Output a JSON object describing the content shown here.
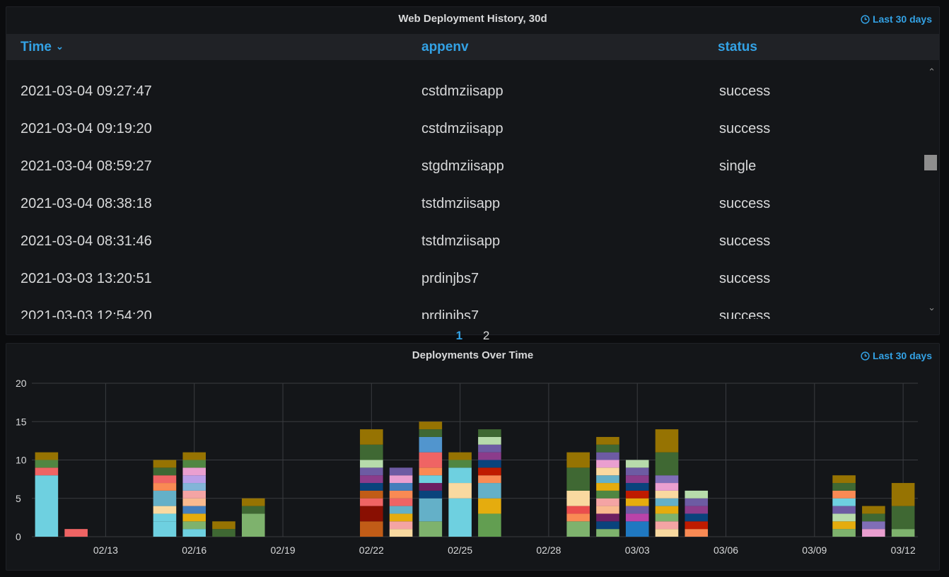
{
  "table_panel": {
    "title": "Web Deployment History, 30d",
    "time_range": "Last 30 days",
    "columns": [
      "Time",
      "appenv",
      "status"
    ],
    "rows": [
      [
        "2021-03-04 09:27:47",
        "cstdmziisapp",
        "success"
      ],
      [
        "2021-03-04 09:19:20",
        "cstdmziisapp",
        "success"
      ],
      [
        "2021-03-04 08:59:27",
        "stgdmziisapp",
        "single"
      ],
      [
        "2021-03-04 08:38:18",
        "tstdmziisapp",
        "success"
      ],
      [
        "2021-03-04 08:31:46",
        "tstdmziisapp",
        "success"
      ],
      [
        "2021-03-03 13:20:51",
        "prdinjbs7",
        "success"
      ],
      [
        "2021-03-03 12:54:20",
        "prdinjbs7",
        "success"
      ]
    ],
    "pages": [
      "1",
      "2"
    ],
    "active_page": "1"
  },
  "chart_panel": {
    "title": "Deployments Over Time",
    "time_range": "Last 30 days"
  },
  "colors": {
    "accent": "#33a2e5",
    "panel_bg": "#141619",
    "page_bg": "#0b0c0e",
    "grid": "#3a3c40"
  },
  "chart_data": {
    "type": "bar",
    "stacked": true,
    "xlabel": "",
    "ylabel": "",
    "ylim": [
      0,
      20
    ],
    "yticks": [
      0,
      5,
      10,
      15,
      20
    ],
    "xticks": [
      "02/13",
      "02/16",
      "02/19",
      "02/22",
      "02/25",
      "02/28",
      "03/03",
      "03/06",
      "03/09",
      "03/12"
    ],
    "x_range": [
      "02/11",
      "03/12"
    ],
    "grid": true,
    "legend": "none",
    "categories": [
      "02/11",
      "02/12",
      "02/15",
      "02/16",
      "02/17",
      "02/18",
      "02/22",
      "02/23",
      "02/24",
      "02/25",
      "02/26",
      "03/01",
      "03/02",
      "03/03",
      "03/04",
      "03/05",
      "03/10",
      "03/11",
      "03/12"
    ],
    "totals": [
      11,
      1,
      10,
      11,
      2,
      5,
      14,
      9,
      15,
      11,
      14,
      11,
      13,
      10,
      14,
      6,
      8,
      4,
      7
    ],
    "segments": [
      [
        [
          8,
          "#6ed0e0"
        ],
        [
          1,
          "#ef6464"
        ],
        [
          1,
          "#508642"
        ],
        [
          1,
          "#967302"
        ]
      ],
      [
        [
          1,
          "#ef6464"
        ]
      ],
      [
        [
          2,
          "#6ed0e0"
        ],
        [
          1,
          "#6ed0e0"
        ],
        [
          1,
          "#f9d9a0"
        ],
        [
          2,
          "#64b0c8"
        ],
        [
          1,
          "#f98a54"
        ],
        [
          1,
          "#ef6464"
        ],
        [
          1,
          "#3f6833"
        ],
        [
          1,
          "#967302"
        ]
      ],
      [
        [
          1,
          "#6ed0e0"
        ],
        [
          1,
          "#7eb26d"
        ],
        [
          1,
          "#e5ac0e"
        ],
        [
          1,
          "#447ebc"
        ],
        [
          1,
          "#f9ba8f"
        ],
        [
          1,
          "#f4a4a4"
        ],
        [
          1,
          "#82b5d8"
        ],
        [
          1,
          "#ba9ee8"
        ],
        [
          1,
          "#ea9fd0"
        ],
        [
          1,
          "#508642"
        ],
        [
          1,
          "#967302"
        ]
      ],
      [
        [
          1,
          "#3f6833"
        ],
        [
          1,
          "#967302"
        ]
      ],
      [
        [
          3,
          "#7eb26d"
        ],
        [
          1,
          "#3f6833"
        ],
        [
          1,
          "#967302"
        ]
      ],
      [
        [
          2,
          "#c15c17"
        ],
        [
          2,
          "#890f02"
        ],
        [
          1,
          "#ef6464"
        ],
        [
          1,
          "#c15c17"
        ],
        [
          1,
          "#0a437c"
        ],
        [
          1,
          "#8b3c8b"
        ],
        [
          1,
          "#6d5ba3"
        ],
        [
          1,
          "#b7dbab"
        ],
        [
          2,
          "#3f6833"
        ],
        [
          2,
          "#967302"
        ]
      ],
      [
        [
          1,
          "#f9d9a0"
        ],
        [
          1,
          "#f4a4a4"
        ],
        [
          1,
          "#e5ac0e"
        ],
        [
          1,
          "#64b0c8"
        ],
        [
          1,
          "#ef6464"
        ],
        [
          1,
          "#f98a54"
        ],
        [
          1,
          "#447ebc"
        ],
        [
          1,
          "#ea9fd0"
        ],
        [
          1,
          "#6d5ba3"
        ]
      ],
      [
        [
          2,
          "#7eb26d"
        ],
        [
          3,
          "#64b0c8"
        ],
        [
          1,
          "#0a437c"
        ],
        [
          1,
          "#6d1f62"
        ],
        [
          1,
          "#6ed0e0"
        ],
        [
          1,
          "#f98a54"
        ],
        [
          2,
          "#ef6464"
        ],
        [
          2,
          "#5195ce"
        ],
        [
          1,
          "#3f6833"
        ],
        [
          1,
          "#967302"
        ]
      ],
      [
        [
          5,
          "#6ed0e0"
        ],
        [
          2,
          "#f9d9a0"
        ],
        [
          2,
          "#6ed0e0"
        ],
        [
          1,
          "#508642"
        ],
        [
          1,
          "#967302"
        ]
      ],
      [
        [
          3,
          "#629e51"
        ],
        [
          2,
          "#e5ac0e"
        ],
        [
          2,
          "#64b0c8"
        ],
        [
          1,
          "#f98a54"
        ],
        [
          1,
          "#bf1b00"
        ],
        [
          1,
          "#0a437c"
        ],
        [
          1,
          "#8b3c8b"
        ],
        [
          1,
          "#6d5ba3"
        ],
        [
          1,
          "#b7dbab"
        ],
        [
          1,
          "#3f6833"
        ]
      ],
      [
        [
          2,
          "#7eb26d"
        ],
        [
          1,
          "#f98a54"
        ],
        [
          1,
          "#ea4d4d"
        ],
        [
          2,
          "#f9d9a0"
        ],
        [
          3,
          "#3f6833"
        ],
        [
          2,
          "#967302"
        ]
      ],
      [
        [
          1,
          "#7eb26d"
        ],
        [
          1,
          "#0a437c"
        ],
        [
          1,
          "#6d1f62"
        ],
        [
          1,
          "#f9ba8f"
        ],
        [
          1,
          "#f4a4a4"
        ],
        [
          1,
          "#508642"
        ],
        [
          1,
          "#e5ac0e"
        ],
        [
          1,
          "#64b0c8"
        ],
        [
          1,
          "#f9d9a0"
        ],
        [
          1,
          "#ea9fd0"
        ],
        [
          1,
          "#6d5ba3"
        ],
        [
          1,
          "#3f6833"
        ],
        [
          1,
          "#967302"
        ]
      ],
      [
        [
          2,
          "#1f78c1"
        ],
        [
          1,
          "#ba43a9"
        ],
        [
          1,
          "#6d5ba3"
        ],
        [
          1,
          "#e5ac0e"
        ],
        [
          1,
          "#bf1b00"
        ],
        [
          1,
          "#0a437c"
        ],
        [
          1,
          "#8b3c8b"
        ],
        [
          1,
          "#6d5ba3"
        ],
        [
          1,
          "#b7dbab"
        ]
      ],
      [
        [
          1,
          "#f9d9a0"
        ],
        [
          1,
          "#f4a4a4"
        ],
        [
          1,
          "#7eb26d"
        ],
        [
          1,
          "#e5ac0e"
        ],
        [
          1,
          "#64b0c8"
        ],
        [
          1,
          "#f9d9a0"
        ],
        [
          1,
          "#ea9fd0"
        ],
        [
          1,
          "#806eb7"
        ],
        [
          3,
          "#3f6833"
        ],
        [
          3,
          "#967302"
        ]
      ],
      [
        [
          1,
          "#f98a54"
        ],
        [
          1,
          "#bf1b00"
        ],
        [
          1,
          "#0a437c"
        ],
        [
          1,
          "#8b3c8b"
        ],
        [
          1,
          "#6d5ba3"
        ],
        [
          1,
          "#b7dbab"
        ]
      ],
      [
        [
          1,
          "#7eb26d"
        ],
        [
          1,
          "#e5ac0e"
        ],
        [
          1,
          "#b7dbab"
        ],
        [
          1,
          "#6d5ba3"
        ],
        [
          1,
          "#6ed0e0"
        ],
        [
          1,
          "#f98a54"
        ],
        [
          1,
          "#3f6833"
        ],
        [
          1,
          "#967302"
        ]
      ],
      [
        [
          1,
          "#ea9fd0"
        ],
        [
          1,
          "#806eb7"
        ],
        [
          1,
          "#3f6833"
        ],
        [
          1,
          "#967302"
        ]
      ],
      [
        [
          1,
          "#7eb26d"
        ],
        [
          3,
          "#3f6833"
        ],
        [
          3,
          "#967302"
        ]
      ]
    ]
  }
}
